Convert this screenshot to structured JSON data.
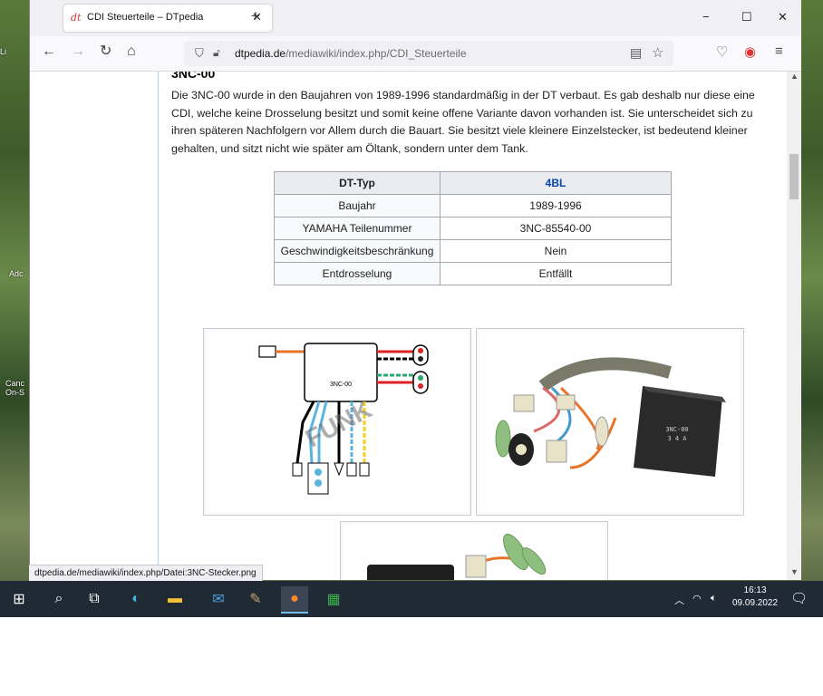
{
  "desktop": {
    "labels": [
      "Li",
      "Adc",
      "Canc\nOn-S"
    ]
  },
  "browser": {
    "tab": {
      "favicon": "dt",
      "title": "CDI Steuerteile – DTpedia"
    },
    "window_controls": {
      "minimize": "−",
      "maximize": "☐",
      "close": "✕"
    },
    "url": {
      "domain": "dtpedia.de",
      "path": "/mediawiki/index.php/CDI_Steuerteile"
    }
  },
  "article": {
    "heading": "3NC-00",
    "paragraph": "Die 3NC-00 wurde in den Baujahren von 1989-1996 standardmäßig in der DT verbaut. Es gab deshalb nur diese eine CDI, welche keine Drosselung besitzt und somit keine offene Variante davon vorhanden ist. Sie unterscheidet sich zu ihren späteren Nachfolgern vor Allem durch die Bauart. Sie besitzt viele kleinere Einzelstecker, ist bedeutend kleiner gehalten, und sitzt nicht wie später am Öltank, sondern unter dem Tank.",
    "table": {
      "header": {
        "label": "DT-Typ",
        "value": "4BL"
      },
      "rows": [
        {
          "label": "Baujahr",
          "value": "1989-1996"
        },
        {
          "label": "YAMAHA Teilenummer",
          "value": "3NC-85540-00"
        },
        {
          "label": "Geschwindigkeitsbeschränkung",
          "value": "Nein"
        },
        {
          "label": "Entdrosselung",
          "value": "Entfällt"
        }
      ]
    },
    "diagram": {
      "box_label": "3NC-00",
      "watermark": "FUNK"
    },
    "photo": {
      "part_label_line1": "3NC-00",
      "part_label_line2": "3 4 A"
    }
  },
  "status_url": "dtpedia.de/mediawiki/index.php/Datei:3NC-Stecker.png",
  "taskbar": {
    "time": "16:13",
    "date": "09.09.2022"
  }
}
